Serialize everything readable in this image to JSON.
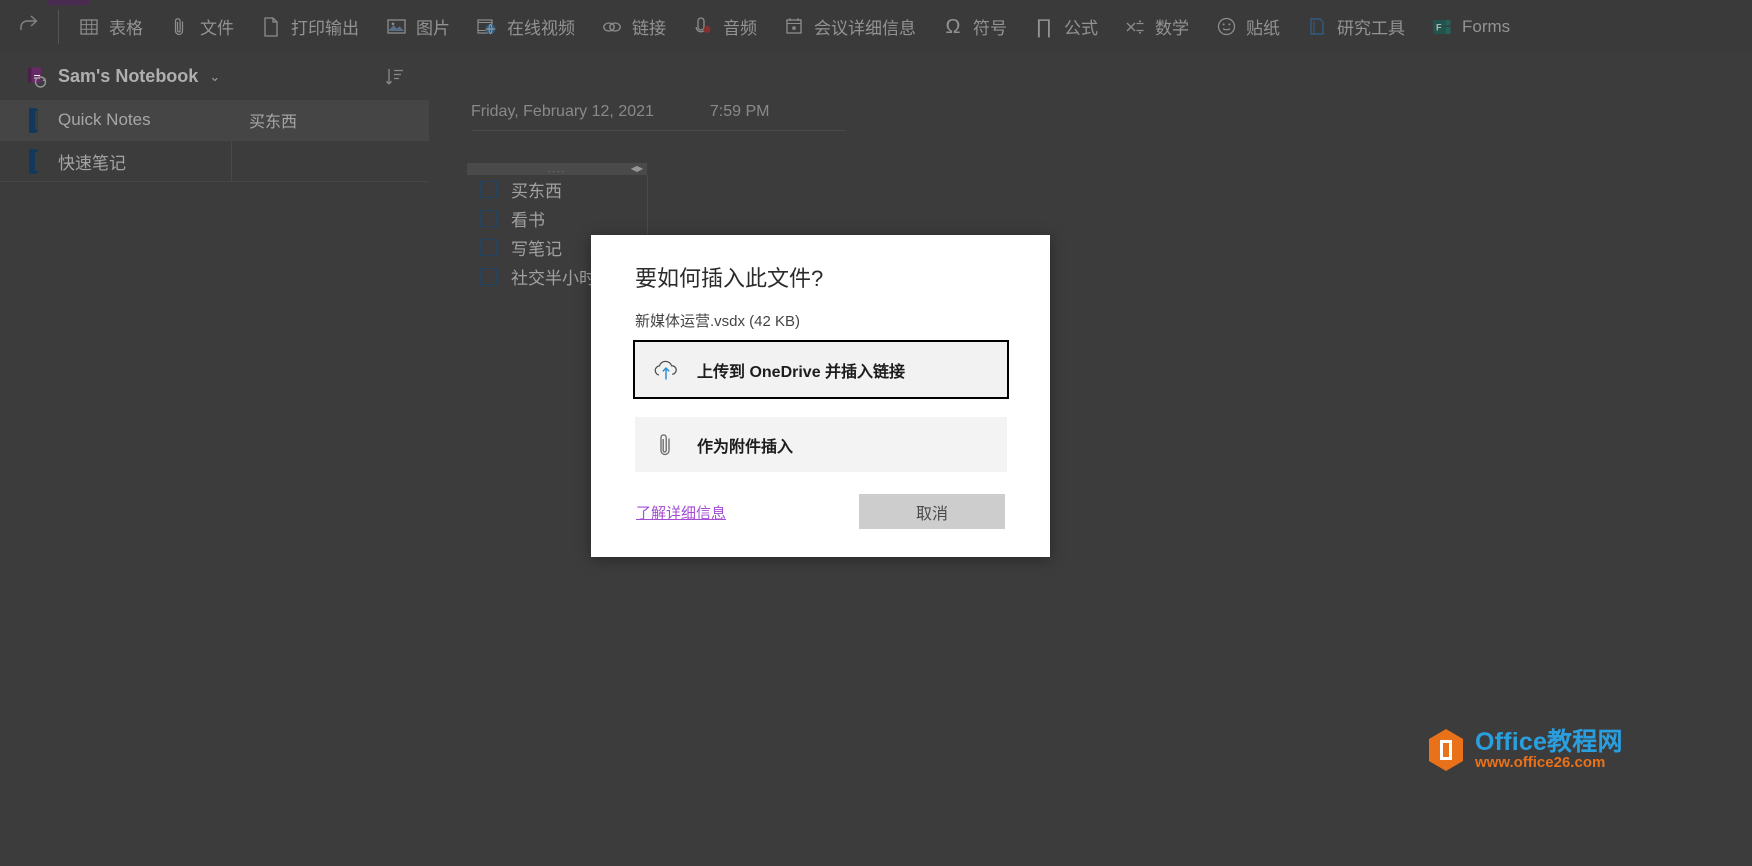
{
  "ribbon": {
    "redo_icon": "redo-icon",
    "items": [
      {
        "label": "表格",
        "icon": "table-icon"
      },
      {
        "label": "文件",
        "icon": "paperclip-file-icon"
      },
      {
        "label": "打印输出",
        "icon": "page-printout-icon"
      },
      {
        "label": "图片",
        "icon": "picture-icon"
      },
      {
        "label": "在线视频",
        "icon": "online-video-icon"
      },
      {
        "label": "链接",
        "icon": "link-icon"
      },
      {
        "label": "音频",
        "icon": "audio-record-icon"
      },
      {
        "label": "会议详细信息",
        "icon": "meeting-details-icon"
      },
      {
        "label": "符号",
        "icon": "omega-symbol-icon"
      },
      {
        "label": "公式",
        "icon": "pi-equation-icon"
      },
      {
        "label": "数学",
        "icon": "math-icon"
      },
      {
        "label": "贴纸",
        "icon": "smiley-sticker-icon"
      },
      {
        "label": "研究工具",
        "icon": "researcher-book-icon"
      },
      {
        "label": "Forms",
        "icon": "forms-icon"
      }
    ]
  },
  "sidebar": {
    "notebook_title": "Sam's Notebook",
    "notebook_chevron": "chevron-down-icon",
    "sort_icon": "sort-descending-icon",
    "sections": [
      {
        "label": "Quick Notes",
        "active": true,
        "page": "买东西"
      },
      {
        "label": "快速笔记",
        "active": false,
        "page": ""
      }
    ]
  },
  "canvas": {
    "date": "Friday, February 12, 2021",
    "time": "7:59 PM",
    "note": {
      "grip_dots": "....",
      "grip_arrows": "◀▶",
      "todos": [
        {
          "label": "买东西",
          "checked": false
        },
        {
          "label": "看书",
          "checked": false
        },
        {
          "label": "写笔记",
          "checked": false
        },
        {
          "label": "社交半小时",
          "checked": false
        }
      ]
    }
  },
  "dialog": {
    "title": "要如何插入此文件?",
    "file_info": "新媒体运营.vsdx (42 KB)",
    "options": [
      {
        "label": "上传到 OneDrive 并插入链接",
        "icon": "cloud-upload-icon",
        "focused": true
      },
      {
        "label": "作为附件插入",
        "icon": "paperclip-icon",
        "focused": false
      }
    ],
    "learn_more": "了解详细信息",
    "cancel": "取消"
  },
  "watermark": {
    "icon": "office-hex-icon",
    "line1": "Office教程网",
    "line2": "www.office26.com"
  },
  "colors": {
    "accent_tab": "#4a2c53",
    "link": "#a44cd3",
    "section_bar": "#12395c",
    "watermark_blue": "#2a9fe0",
    "watermark_orange": "#e8711a"
  }
}
